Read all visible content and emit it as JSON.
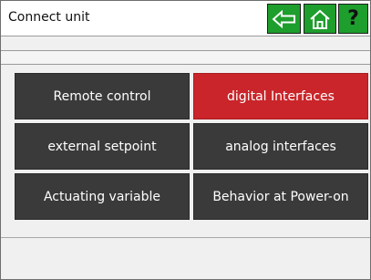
{
  "header": {
    "title": "Connect unit",
    "buttons": {
      "back_icon": "arrow-left-icon",
      "home_icon": "home-icon",
      "help_label": "?"
    }
  },
  "menu": {
    "items": [
      {
        "label": "Remote control",
        "active": false
      },
      {
        "label": "digital Interfaces",
        "active": true
      },
      {
        "label": "external setpoint",
        "active": false
      },
      {
        "label": "analog interfaces",
        "active": false
      },
      {
        "label": "Actuating variable",
        "active": false
      },
      {
        "label": "Behavior at Power-on",
        "active": false
      }
    ]
  },
  "colors": {
    "header_button": "#1e9e2c",
    "menu_button": "#3a3a3a",
    "menu_button_active": "#c9252a",
    "menu_text": "#ffffff"
  }
}
